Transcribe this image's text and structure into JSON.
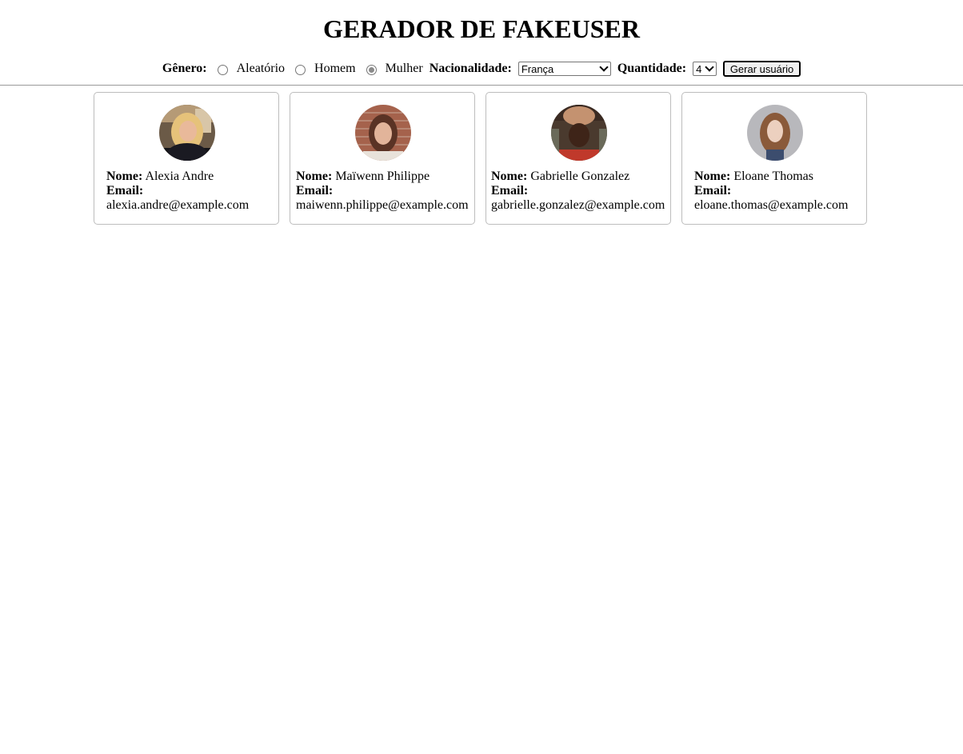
{
  "title": "GERADOR DE FAKEUSER",
  "controls": {
    "gender_label": "Gênero:",
    "gender_options": [
      "Aleatório",
      "Homem",
      "Mulher"
    ],
    "gender_selected": "Mulher",
    "nationality_label": "Nacionalidade:",
    "nationality_value": "França",
    "quantity_label": "Quantidade:",
    "quantity_value": "4",
    "generate_button": "Gerar usuário"
  },
  "labels": {
    "name": "Nome:",
    "email": "Email:"
  },
  "users": [
    {
      "name": "Alexia Andre",
      "email": "alexia.andre@example.com",
      "avatar": "woman-blonde-hair-photo"
    },
    {
      "name": "Maïwenn Philippe",
      "email": "maiwenn.philippe@example.com",
      "avatar": "woman-brick-wall-photo"
    },
    {
      "name": "Gabrielle Gonzalez",
      "email": "gabrielle.gonzalez@example.com",
      "avatar": "woman-headwrap-photo"
    },
    {
      "name": "Eloane Thomas",
      "email": "eloane.thomas@example.com",
      "avatar": "woman-red-hair-photo"
    }
  ]
}
